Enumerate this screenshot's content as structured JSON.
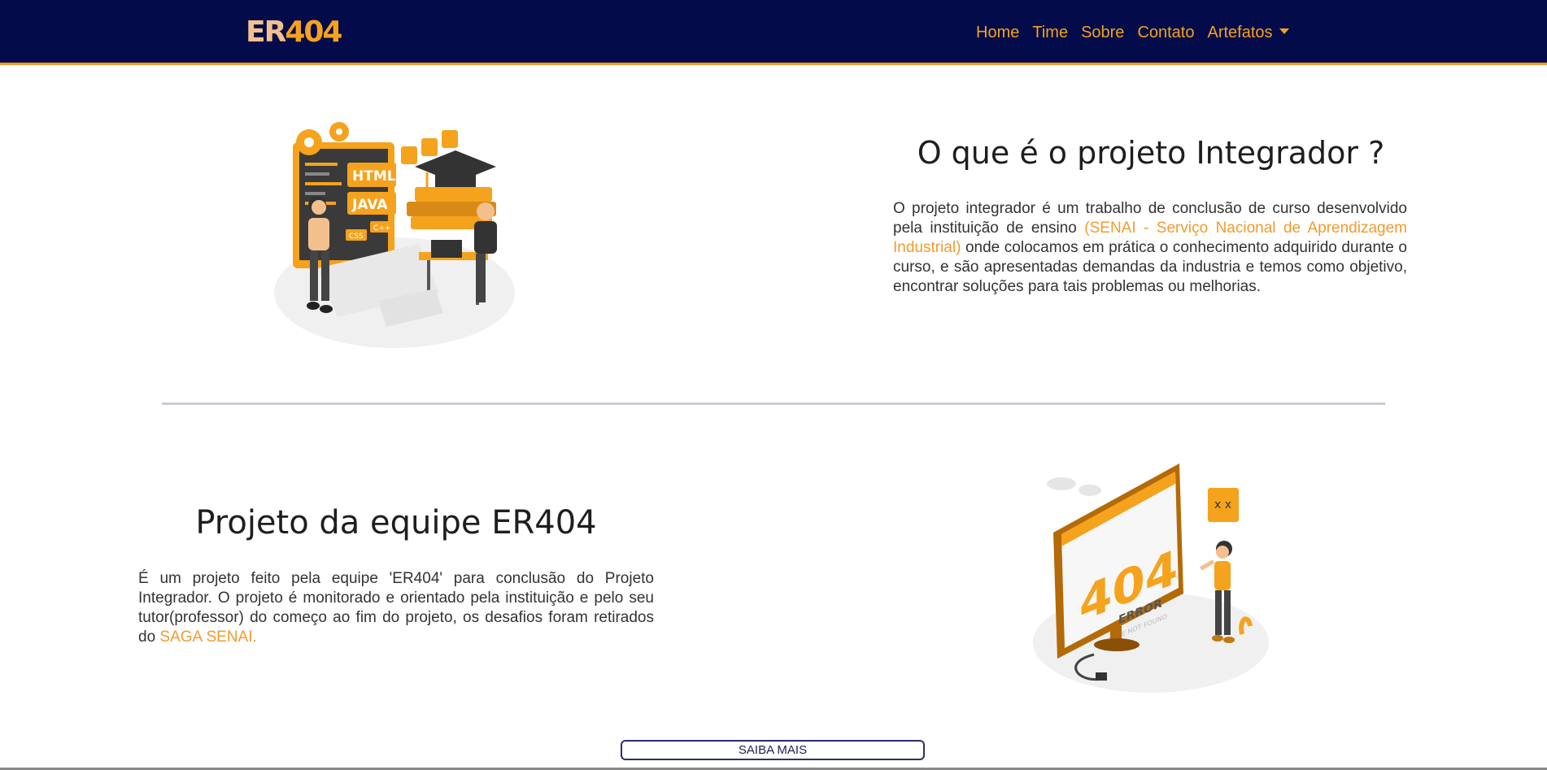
{
  "navbar": {
    "logo_part1": "ER",
    "logo_part2": "404",
    "links": [
      "Home",
      "Time",
      "Sobre",
      "Contato",
      "Artefatos"
    ]
  },
  "section1": {
    "title": "O que é o projeto Integrador ?",
    "text_before": " O projeto integrador é um trabalho de conclusão de curso desenvolvido pela instituição de ensino ",
    "highlight": "(SENAI - Serviço Nacional de Aprendizagem Industrial)",
    "text_after": " onde colocamos em prática o conhecimento adquirido durante o curso, e são apresentadas demandas da industria e temos como objetivo, encontrar soluções para tais problemas ou melhorias.",
    "illustration_labels": [
      "HTML",
      "JAVA",
      "CSS",
      "C++"
    ]
  },
  "section2": {
    "title": "Projeto da equipe ER404",
    "text_before": " É um projeto feito pela equipe 'ER404' para conclusão do Projeto Integrador. O projeto é monitorado e orientado pela instituição e pelo seu tutor(professor) do começo ao fim do projeto, os desafios foram retirados do ",
    "highlight": "SAGA SENAI.",
    "illustration_code": "404",
    "illustration_error": "ERROR",
    "illustration_sub": "PAGE NOT FOUND"
  },
  "button": {
    "label": "SAIBA MAIS"
  },
  "colors": {
    "navbar": "#040b4a",
    "accent": "#f5a21d",
    "divider": "#c9cbd6"
  }
}
